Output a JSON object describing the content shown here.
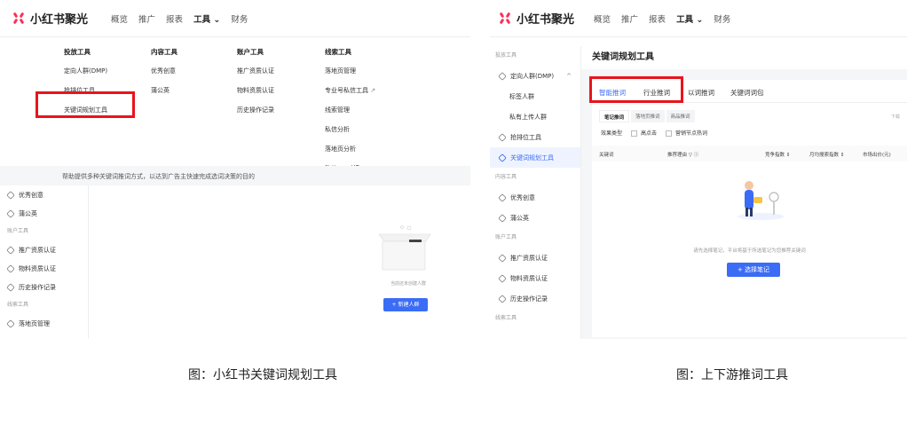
{
  "left": {
    "logo": "小红书聚光",
    "nav": [
      "概览",
      "推广",
      "报表",
      "工具 ⌄",
      "财务"
    ],
    "mega_menu": [
      {
        "header": "投放工具",
        "items": [
          "定向人群(DMP)",
          "抢排位工具",
          "关键词规划工具"
        ]
      },
      {
        "header": "内容工具",
        "items": [
          "优秀创意",
          "蒲公英"
        ]
      },
      {
        "header": "账户工具",
        "items": [
          "推广资质认证",
          "物料资质认证",
          "历史操作记录"
        ]
      },
      {
        "header": "线索工具",
        "items": [
          "落地页管理",
          "专业号私信工具",
          "线索管理",
          "私信分析",
          "落地页分析",
          "私信API对接"
        ]
      }
    ],
    "hint": "帮助提供多种关键词推词方式，以达到广告主快速完成选词决策的目的",
    "sidebar": [
      {
        "type": "item",
        "label": "优秀创意"
      },
      {
        "type": "item",
        "label": "蒲公英"
      },
      {
        "type": "cat",
        "label": "账户工具"
      },
      {
        "type": "item",
        "label": "推广资质认证"
      },
      {
        "type": "item",
        "label": "物料资质认证"
      },
      {
        "type": "item",
        "label": "历史操作记录"
      },
      {
        "type": "cat",
        "label": "线索工具"
      },
      {
        "type": "item",
        "label": "落地页管理"
      }
    ],
    "empty_text": "当前还未创建人群",
    "new_button": "+ 新建人群"
  },
  "right": {
    "logo": "小红书聚光",
    "nav": [
      "概览",
      "推广",
      "报表",
      "工具 ⌄",
      "财务"
    ],
    "sidebar": [
      {
        "type": "cat",
        "label": "投放工具"
      },
      {
        "type": "item",
        "label": "定向人群(DMP)",
        "chev": "^"
      },
      {
        "type": "sub",
        "label": "标签人群"
      },
      {
        "type": "sub",
        "label": "私有上传人群"
      },
      {
        "type": "item",
        "label": "抢排位工具"
      },
      {
        "type": "active",
        "label": "关键词规划工具"
      },
      {
        "type": "cat",
        "label": "内容工具"
      },
      {
        "type": "item",
        "label": "优秀创意"
      },
      {
        "type": "item",
        "label": "蒲公英"
      },
      {
        "type": "cat",
        "label": "账户工具"
      },
      {
        "type": "item",
        "label": "推广资质认证"
      },
      {
        "type": "item",
        "label": "物料资质认证"
      },
      {
        "type": "item",
        "label": "历史操作记录"
      },
      {
        "type": "cat",
        "label": "线索工具"
      }
    ],
    "page_title": "关键词规划工具",
    "tabs": [
      "智能推词",
      "行业推词",
      "以词推词",
      "关键词词包"
    ],
    "subtabs": [
      "笔记推词",
      "落地页推词",
      "商品推词"
    ],
    "more_label": "下载",
    "filters": {
      "label": "效果类型",
      "options": [
        "高点击",
        "营销节点热词"
      ]
    },
    "columns": [
      "关键词",
      "推荐理由 ▽ ⓘ",
      "竞争指数 ⇕",
      "月均搜索指数 ⇕",
      "市场出价(元)"
    ],
    "empty_text": "请先选择笔记，平台将基于所选笔记为您推荐关键词",
    "select_button": "+ 选择笔记"
  },
  "captions": [
    "图：小红书关键词规划工具",
    "图：上下游推词工具"
  ],
  "colors": {
    "accent": "#3b6cf6",
    "highlight": "#e8141c",
    "brand": "#ff2d55"
  }
}
